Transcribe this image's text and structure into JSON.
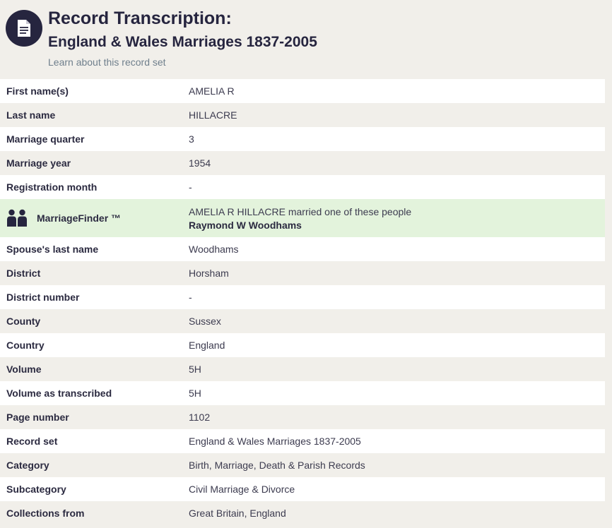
{
  "header": {
    "title": "Record Transcription:",
    "subtitle": "England & Wales Marriages 1837-2005",
    "learn_link": "Learn about this record set",
    "icon": "document-icon"
  },
  "rows_before": [
    {
      "label": "First name(s)",
      "value": "AMELIA R"
    },
    {
      "label": "Last name",
      "value": "HILLACRE"
    },
    {
      "label": "Marriage quarter",
      "value": "3"
    },
    {
      "label": "Marriage year",
      "value": "1954"
    },
    {
      "label": "Registration month",
      "value": "-"
    }
  ],
  "marriage_finder": {
    "label": "MarriageFinder ™",
    "line1": "AMELIA R HILLACRE married one of these people",
    "spouse": "Raymond W Woodhams",
    "icon": "people-icon"
  },
  "rows_after": [
    {
      "label": "Spouse's last name",
      "value": "Woodhams"
    },
    {
      "label": "District",
      "value": "Horsham"
    },
    {
      "label": "District number",
      "value": "-"
    },
    {
      "label": "County",
      "value": "Sussex"
    },
    {
      "label": "Country",
      "value": "England"
    },
    {
      "label": "Volume",
      "value": "5H"
    },
    {
      "label": "Volume as transcribed",
      "value": "5H"
    },
    {
      "label": "Page number",
      "value": "1102"
    },
    {
      "label": "Record set",
      "value": "England & Wales Marriages 1837-2005"
    },
    {
      "label": "Category",
      "value": "Birth, Marriage, Death & Parish Records"
    },
    {
      "label": "Subcategory",
      "value": "Civil Marriage & Divorce"
    },
    {
      "label": "Collections from",
      "value": "Great Britain, England"
    }
  ],
  "colors": {
    "navy": "#26253f",
    "row_alt": "#f1efea",
    "highlight_green": "#e3f3dc",
    "link": "#6f7f8c"
  }
}
